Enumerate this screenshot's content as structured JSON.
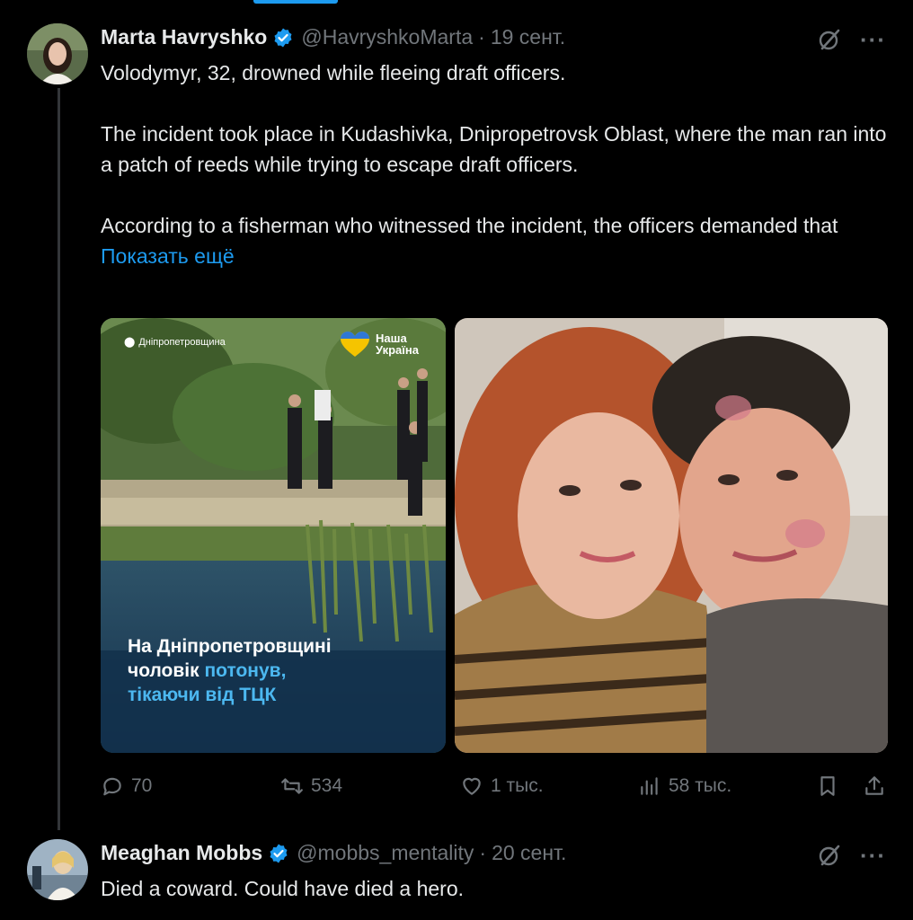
{
  "tweet1": {
    "author_name": "Marta Havryshko",
    "handle": "@HavryshkoMarta",
    "separator": "·",
    "date": "19 сент.",
    "paragraphs": [
      "Volodymyr, 32, drowned while fleeing draft officers.",
      "The incident took place in Kudashivka, Dnipropetrovsk Oblast, where the man ran into a patch of reeds while trying to escape draft officers.",
      "According to a fisherman who witnessed the incident, the officers demanded that"
    ],
    "show_more": "Показать ещё",
    "media1": {
      "location": "Дніпропетровщина",
      "brand_line1": "Наша",
      "brand_line2": "Україна",
      "caption_line1": "На Дніпропетровщині",
      "caption_line2_a": "чоловік ",
      "caption_line2_b": "потонув,",
      "caption_line3": "тікаючи від ТЦК"
    },
    "stats": {
      "replies": "70",
      "reposts": "534",
      "likes": "1 тыс.",
      "views": "58 тыс."
    }
  },
  "tweet2": {
    "author_name": "Meaghan Mobbs",
    "handle": "@mobbs_mentality",
    "separator": "·",
    "date": "20 сент.",
    "text": "Died a coward. Could have died a hero."
  },
  "icons": {
    "more": "···"
  },
  "colors": {
    "accent": "#1d9bf0",
    "background": "#000000",
    "text": "#e7e9ea",
    "muted": "#71767b"
  }
}
